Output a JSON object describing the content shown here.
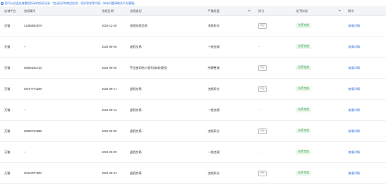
{
  "notice": {
    "text": "您可以在此处查看您所有的投诉记录，包括投诉的商品信息、投诉状态等内容，如有问题请联系平台客服。"
  },
  "columns": [
    {
      "key": "platform",
      "label": "店铺平台"
    },
    {
      "key": "order_no",
      "label": "违规编号"
    },
    {
      "key": "date",
      "label": "违规日期"
    },
    {
      "key": "type",
      "label": "违规类型"
    },
    {
      "key": "severity",
      "label": "严重程度"
    },
    {
      "key": "points",
      "label": "扣分"
    },
    {
      "key": "appeal",
      "label": "处罚状态"
    },
    {
      "key": "action",
      "label": "操作"
    }
  ],
  "rows": [
    {
      "platform": "天猫",
      "order_no": "41386692579",
      "date": "2024-11-20",
      "type": "违规违禁信息",
      "severity": "违规扣分",
      "points": "0分",
      "appeal": "处罚完成",
      "action": "查看详情"
    },
    {
      "platform": "天猫",
      "order_no": "--",
      "date": "2024-09-26",
      "type": "虚假交易",
      "severity": "一般违规",
      "points": "--",
      "appeal": "处罚完成",
      "action": "查看详情"
    },
    {
      "platform": "天猫",
      "order_no": "30660202710",
      "date": "2024-09-25",
      "type": "不当使用他人权利(商标侵权)",
      "severity": "所需整改",
      "points": "0分",
      "appeal": "处罚完成",
      "action": "查看详情"
    },
    {
      "platform": "天猫",
      "order_no": "39747773299",
      "date": "2024-09-17",
      "type": "虚假交易",
      "severity": "违规扣分",
      "points": "0分",
      "appeal": "处罚完成",
      "action": "查看详情"
    },
    {
      "platform": "天猫",
      "order_no": "--",
      "date": "2024-09-13",
      "type": "虚假交易",
      "severity": "一般违规",
      "points": "--",
      "appeal": "处罚完成",
      "action": "查看详情"
    },
    {
      "platform": "天猫",
      "order_no": "30660724865",
      "date": "2024-09-09",
      "type": "虚假交易",
      "severity": "违规扣分",
      "points": "0分",
      "appeal": "处罚完成",
      "action": "查看详情"
    },
    {
      "platform": "天猫",
      "order_no": "--",
      "date": "2024-09-09",
      "type": "虚假交易",
      "severity": "一般违规",
      "points": "--",
      "appeal": "处罚完成",
      "action": "查看详情"
    },
    {
      "platform": "天猫",
      "order_no": "30442077602",
      "date": "2024-09-01",
      "type": "虚假交易",
      "severity": "违规扣分",
      "points": "0分",
      "appeal": "处罚完成",
      "action": "查看详情"
    }
  ]
}
